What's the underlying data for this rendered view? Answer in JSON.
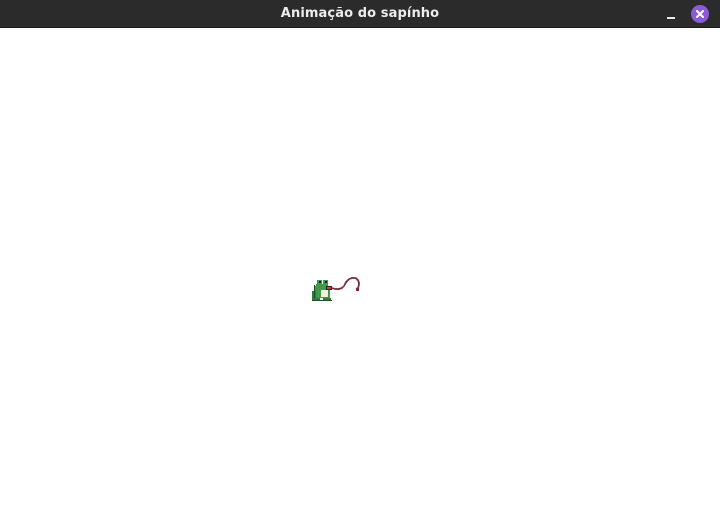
{
  "window": {
    "title": "Animação do sapínho",
    "icons": {
      "minimize": "minimize-icon",
      "close": "close-icon",
      "sprite": "frog-sprite"
    },
    "colors": {
      "titlebar": "#2b2b2b",
      "title_text": "#ededed",
      "close_button": "#8a5bd6",
      "canvas": "#ffffff",
      "frog_green": "#3c9a4a",
      "frog_belly": "#f2eee0",
      "tongue": "#b2475a"
    }
  }
}
